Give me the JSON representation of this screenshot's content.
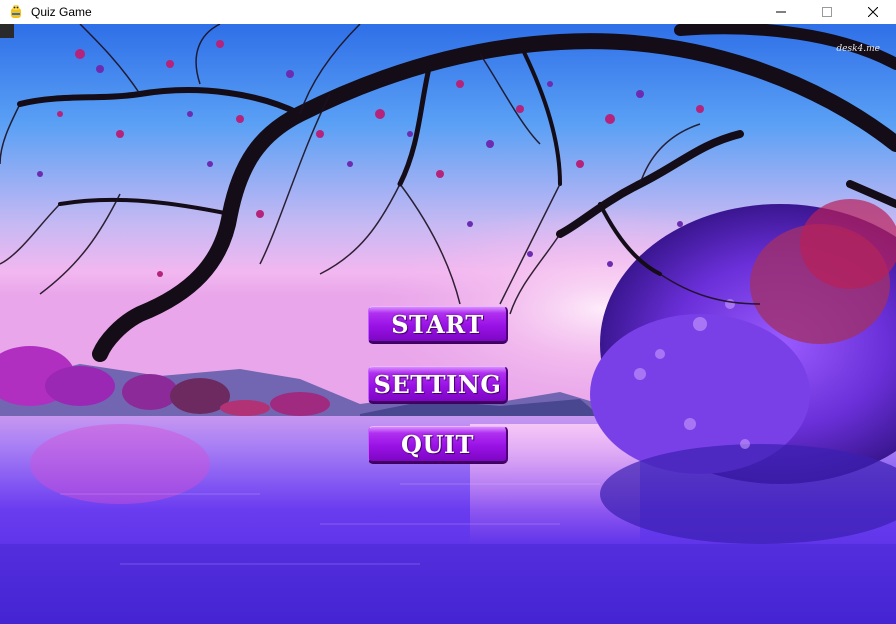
{
  "window": {
    "title": "Quiz Game",
    "controls": [
      "minimize-icon",
      "maximize-icon",
      "close-icon"
    ]
  },
  "scene": {
    "background": "lakeside-tree-sunset-image",
    "watermark": "desk4.me"
  },
  "menu": {
    "start_label": "START",
    "setting_label": "SETTING",
    "quit_label": "QUIT"
  },
  "colors": {
    "button_top": "#d98cff",
    "button_bottom": "#7d06c4",
    "sky_pink": "#f2b7f0",
    "water_blue": "#6a3cf0"
  }
}
